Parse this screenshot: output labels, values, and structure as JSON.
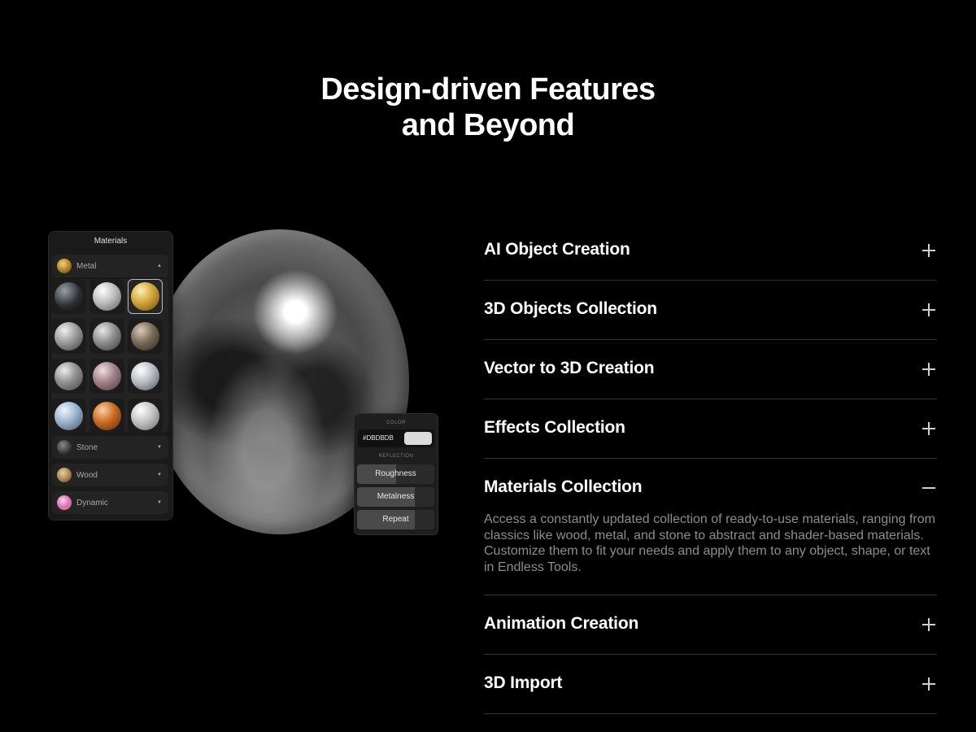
{
  "heading": {
    "line1": "Design-driven Features",
    "line2": "and Beyond"
  },
  "materials_panel": {
    "title": "Materials",
    "open_category": "Metal",
    "categories": [
      "Stone",
      "Wood",
      "Dynamic"
    ],
    "swatches": [
      "dark-metal",
      "silver",
      "gold",
      "hammered-silver",
      "brushed-silver",
      "bronze",
      "patterned-metal",
      "rose-metal",
      "chrome",
      "blue-steel",
      "copper",
      "polished-silver"
    ],
    "selected_swatch": "gold"
  },
  "reflection_panel": {
    "color_caption": "COLOR",
    "color_hex": "#DBDBDB",
    "reflection_caption": "REFLECTION",
    "sliders": [
      {
        "label": "Roughness",
        "value": 0.5
      },
      {
        "label": "Metalness",
        "value": 0.75
      },
      {
        "label": "Repeat",
        "value": 0.75
      }
    ]
  },
  "accordion": {
    "items": [
      {
        "title": "AI Object Creation",
        "expanded": false
      },
      {
        "title": "3D Objects Collection",
        "expanded": false
      },
      {
        "title": "Vector to 3D Creation",
        "expanded": false
      },
      {
        "title": "Effects Collection",
        "expanded": false
      },
      {
        "title": "Materials Collection",
        "expanded": true,
        "body": "Access a constantly updated collection of ready-to-use materials, ranging from classics like wood, metal, and stone to abstract and shader-based materials. Customize them to fit your needs and apply them to any object, shape, or text in Endless Tools."
      },
      {
        "title": "Animation Creation",
        "expanded": false
      },
      {
        "title": "3D Import",
        "expanded": false
      }
    ]
  },
  "colors": {
    "background": "#000000",
    "text": "#ffffff",
    "muted_text": "#8d8d8d",
    "divider": "#333333"
  }
}
